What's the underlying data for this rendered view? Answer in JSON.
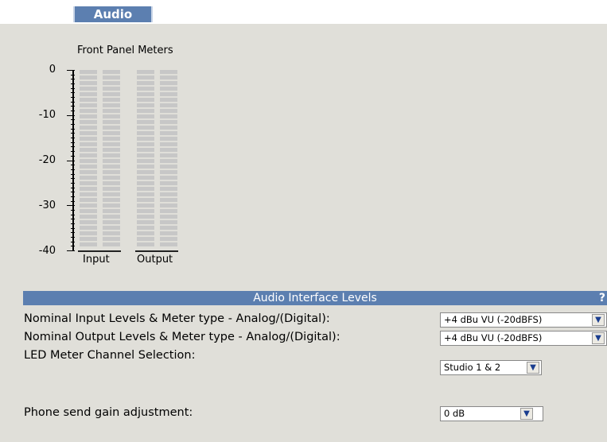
{
  "tab": {
    "label": "Audio"
  },
  "meters": {
    "title": "Front Panel Meters",
    "scale": [
      "0",
      "-10",
      "-20",
      "-30",
      "-40"
    ],
    "channels": [
      "Input",
      "Output"
    ]
  },
  "section": {
    "title": "Audio Interface Levels",
    "help": "?"
  },
  "settings": [
    {
      "label": "Nominal Input Levels & Meter type - Analog/(Digital):",
      "value": "+4 dBu VU (-20dBFS)"
    },
    {
      "label": "Nominal Output Levels & Meter type - Analog/(Digital):",
      "value": "+4 dBu VU (-20dBFS)"
    },
    {
      "label": "LED Meter Channel Selection:",
      "value": "Studio 1 & 2"
    },
    {
      "label": "Phone send gain adjustment:",
      "value": "0 dB"
    }
  ],
  "icons": {
    "dropdown": "chevron-down-icon"
  }
}
